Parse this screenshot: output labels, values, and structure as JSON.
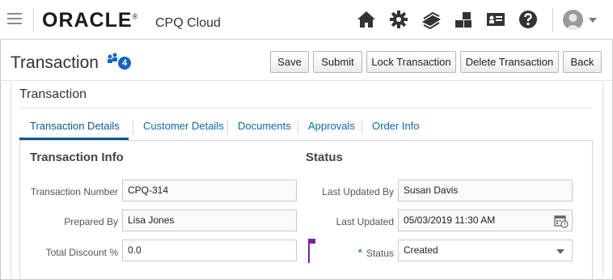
{
  "header": {
    "brand": "ORACLE",
    "brand_mark": "®",
    "product": "CPQ Cloud",
    "icons": [
      "home-icon",
      "gear-icon",
      "documents-stack-icon",
      "boxes-icon",
      "contact-card-icon",
      "help-icon"
    ]
  },
  "titlebar": {
    "title": "Transaction",
    "participants_count": "4",
    "buttons": {
      "save": "Save",
      "submit": "Submit",
      "lock": "Lock Transaction",
      "delete": "Delete Transaction",
      "back": "Back"
    }
  },
  "main": {
    "section_title": "Transaction",
    "tabs": [
      {
        "label": "Transaction Details",
        "active": true
      },
      {
        "label": "Customer Details",
        "active": false
      },
      {
        "label": "Documents",
        "active": false
      },
      {
        "label": "Approvals",
        "active": false
      },
      {
        "label": "Order Info",
        "active": false
      }
    ],
    "transaction_info": {
      "title": "Transaction Info",
      "transaction_number_label": "Transaction Number",
      "transaction_number": "CPQ-314",
      "prepared_by_label": "Prepared By",
      "prepared_by": "Lisa Jones",
      "total_discount_label": "Total Discount %",
      "total_discount": "0.0"
    },
    "status": {
      "title": "Status",
      "last_updated_by_label": "Last Updated By",
      "last_updated_by": "Susan Davis",
      "last_updated_label": "Last Updated",
      "last_updated": "05/03/2019 11:30 AM",
      "required_mark": "*",
      "status_label": "Status",
      "status_value": "Created"
    }
  },
  "colors": {
    "link": "#0a6aa6",
    "active_tab": "#0a5790",
    "badge": "#1565c0",
    "flag": "#7b1fa2"
  }
}
